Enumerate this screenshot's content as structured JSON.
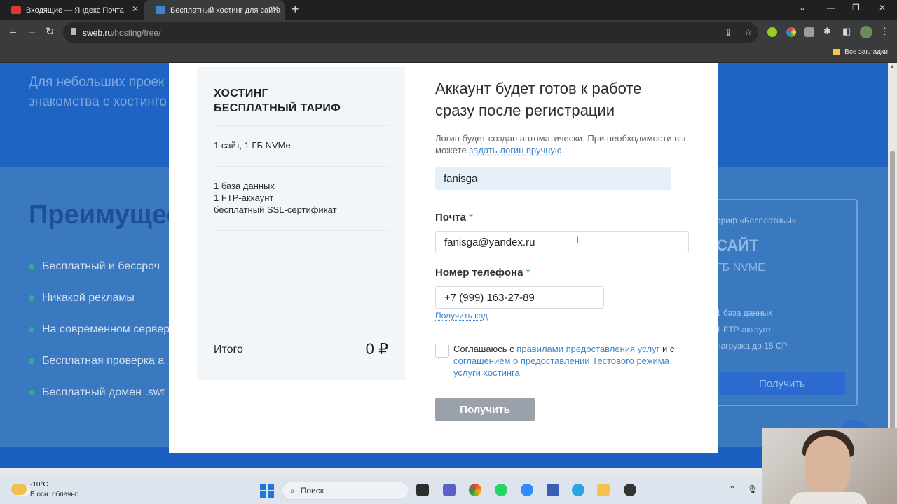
{
  "browser": {
    "tabs": [
      {
        "title": "Входящие — Яндекс Почта",
        "active": false
      },
      {
        "title": "Бесплатный хостинг для сайта",
        "active": true
      }
    ],
    "url_host": "sweb.ru",
    "url_path": "/hosting/free/",
    "bookmarks_label": "Все закладки"
  },
  "background_page": {
    "hero_text_line1": "Для небольших проек",
    "hero_text_line2": "знакомства с хостинго",
    "advantages_title": "Преимущес",
    "advantages": [
      "Бесплатный и бессроч",
      "Никакой рекламы",
      "На современном сервер",
      "Бесплатная проверка а",
      "Бесплатный домен .swt"
    ],
    "tariff_card": {
      "title": "ариф «Бесплатный»",
      "big": "САЙТ",
      "sub": "ГБ NVME",
      "lines": [
        "1 база данных",
        "1 FTP-аккаунт",
        "нагрузка до 15 CP"
      ],
      "button": "Получить"
    }
  },
  "modal": {
    "summary": {
      "title_line1": "ХОСТИНГ",
      "title_line2": "БЕСПЛАТНЫЙ ТАРИФ",
      "item1": "1 сайт, 1 ГБ NVMe",
      "item2_lines": [
        "1 база данных",
        "1 FTP-аккаунт",
        "бесплатный SSL-сертификат"
      ],
      "total_label": "Итого",
      "total_value": "0 ₽"
    },
    "form": {
      "title": "Аккаунт будет готов к работе сразу после регистрации",
      "hint_text": "Логин будет создан автоматически. При необходимости вы можете ",
      "hint_link": "задать логин вручную",
      "hint_end": ".",
      "login_value": "fanisga",
      "email_label": "Почта",
      "email_value": "fanisga@yandex.ru",
      "phone_label": "Номер телефона",
      "phone_value": "+7 (999) 163-27-89",
      "required_mark": "*",
      "get_code_link": "Получить код",
      "agree_prefix": "Соглашаюсь с ",
      "agree_link1": "правилами предоставления услуг",
      "agree_middle": " и с ",
      "agree_link2": "соглашением о предоставлении Тестового режима услуги хостинга",
      "agree_checked": false,
      "submit_label": "Получить"
    }
  },
  "taskbar": {
    "temperature": "-10°C",
    "weather": "В осн. облачно",
    "search_placeholder": "Поиск"
  },
  "colors": {
    "accent_blue": "#3e86c9",
    "required_green": "#2bb18f",
    "submit_disabled": "#9aa1aa",
    "hero_blue": "#1f64c3"
  }
}
